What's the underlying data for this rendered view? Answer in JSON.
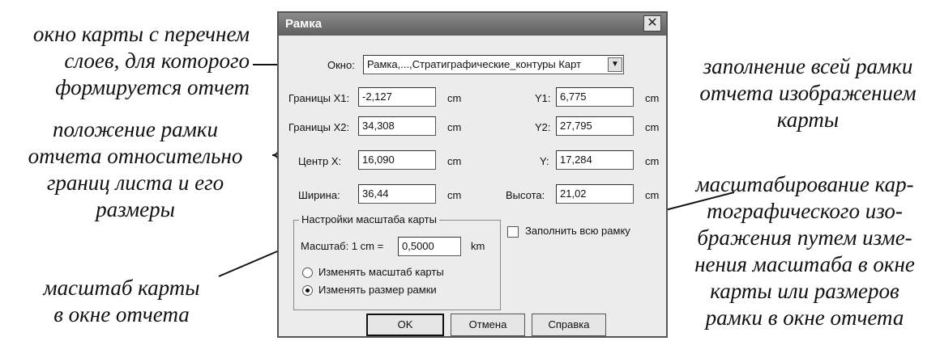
{
  "annotations": {
    "window": [
      "окно карты с перечнем",
      "слоев, для которого",
      "формируется отчет"
    ],
    "position": [
      "положение рамки",
      "отчета относительно",
      "границ листа и его",
      "размеры"
    ],
    "map_scale": [
      "масштаб карты",
      "в окне отчета"
    ],
    "fill_frame": [
      "заполнение всей рамки",
      "отчета изображением",
      "карты"
    ],
    "scaling": [
      "масштабирование кар-",
      "тографического изо-",
      "бражения путем изме-",
      "нения масштаба в окне",
      "карты или размеров",
      "рамки в окне отчета"
    ]
  },
  "dialog": {
    "title": "Рамка",
    "close_glyph": "✕",
    "window_label": "Окно:",
    "window_value": "Рамка,...,Стратиграфические_контуры Карт",
    "combo_arrow": "▼",
    "rows": [
      {
        "left_label": "Границы X1:",
        "left_value": "-2,127",
        "left_unit": "cm",
        "right_label": "Y1:",
        "right_value": "6,775",
        "right_unit": "cm"
      },
      {
        "left_label": "Границы X2:",
        "left_value": "34,308",
        "left_unit": "cm",
        "right_label": "Y2:",
        "right_value": "27,795",
        "right_unit": "cm"
      },
      {
        "left_label": "Центр X:",
        "left_value": "16,090",
        "left_unit": "cm",
        "right_label": "Y:",
        "right_value": "17,284",
        "right_unit": "cm"
      },
      {
        "left_label": "Ширина:",
        "left_value": "36,44",
        "left_unit": "cm",
        "right_label": "Высота:",
        "right_value": "21,02",
        "right_unit": "cm"
      }
    ],
    "scale_group": {
      "title": "Настройки масштаба карты",
      "scale_label": "Масштаб: 1 cm =",
      "scale_value": "0,5000",
      "scale_unit": "km",
      "radio_change_scale": "Изменять масштаб карты",
      "radio_change_frame": "Изменять размер рамки",
      "selected": "Изменять размер рамки"
    },
    "fill_checkbox_label": "Заполнить всю рамку",
    "fill_checked": false,
    "buttons": {
      "ok": "OK",
      "cancel": "Отмена",
      "help": "Справка"
    }
  }
}
